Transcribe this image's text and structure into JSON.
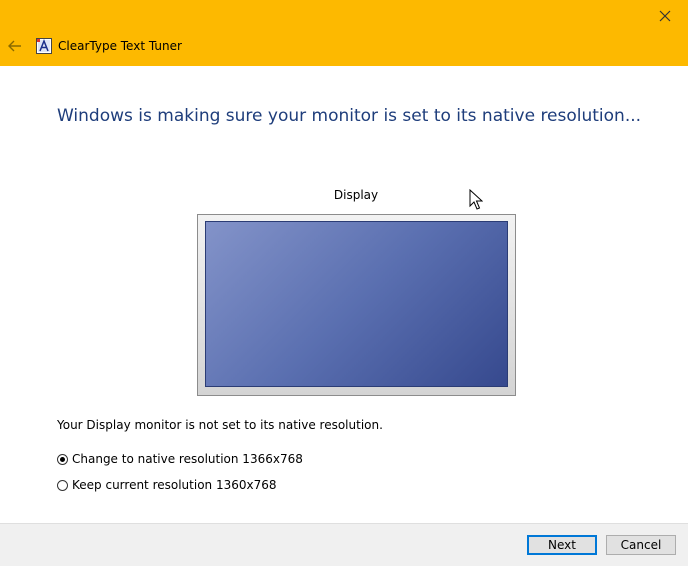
{
  "window": {
    "title": "ClearType Text Tuner",
    "icons": {
      "back": "back-arrow-icon",
      "app": "cleartype-app-icon",
      "close": "close-icon"
    },
    "accent_color": "#fdb900"
  },
  "content": {
    "heading": "Windows is making sure your monitor is set to its native resolution...",
    "display_label": "Display",
    "message": "Your Display monitor is not set to its native resolution.",
    "options": [
      {
        "label": "Change to native resolution 1366x768",
        "selected": true
      },
      {
        "label": "Keep current resolution 1360x768",
        "selected": false
      }
    ]
  },
  "buttons": {
    "next": "Next",
    "cancel": "Cancel"
  }
}
